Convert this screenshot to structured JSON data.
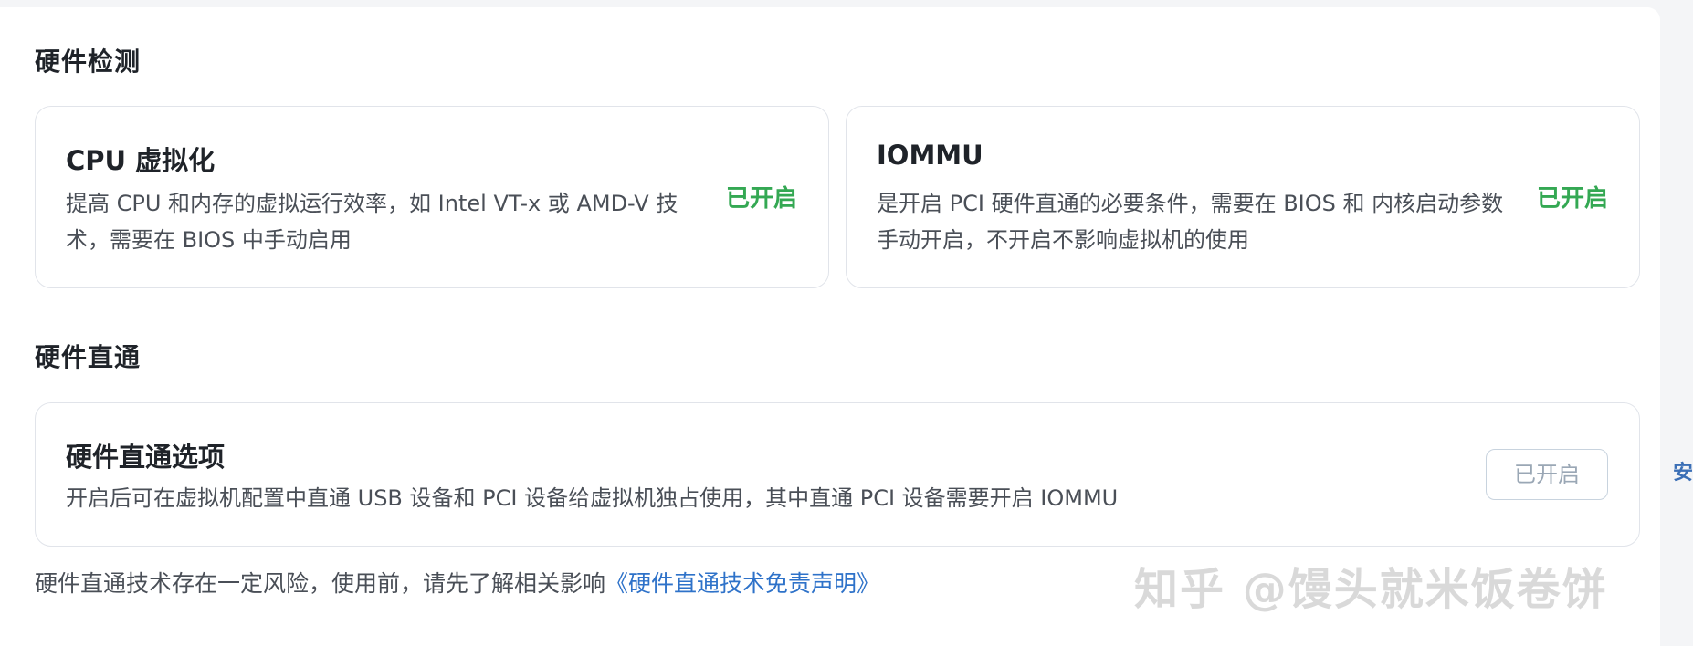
{
  "sections": {
    "detect_title": "硬件检测",
    "passthrough_title": "硬件直通"
  },
  "cards": {
    "cpu": {
      "title": "CPU 虚拟化",
      "desc": "提高 CPU 和内存的虚拟运行效率，如 Intel VT-x 或 AMD-V 技术，需要在 BIOS 中手动启用",
      "status": "已开启"
    },
    "iommu": {
      "title": "IOMMU",
      "desc": "是开启 PCI 硬件直通的必要条件，需要在 BIOS 和 内核启动参数手动开启，不开启不影响虚拟机的使用",
      "status": "已开启"
    },
    "passthrough": {
      "title": "硬件直通选项",
      "desc": "开启后可在虚拟机配置中直通 USB 设备和 PCI 设备给虚拟机独占使用，其中直通 PCI 设备需要开启 IOMMU",
      "button_label": "已开启"
    }
  },
  "footnote": {
    "text": "硬件直通技术存在一定风险，使用前，请先了解相关影响",
    "link_text": "《硬件直通技术免责声明》"
  },
  "watermark": "知乎 @馒头就米饭卷饼",
  "edge": {
    "glyph": "安"
  },
  "colors": {
    "status_green": "#34a853",
    "link_blue": "#2e72c9",
    "border": "#e1e4ea"
  }
}
